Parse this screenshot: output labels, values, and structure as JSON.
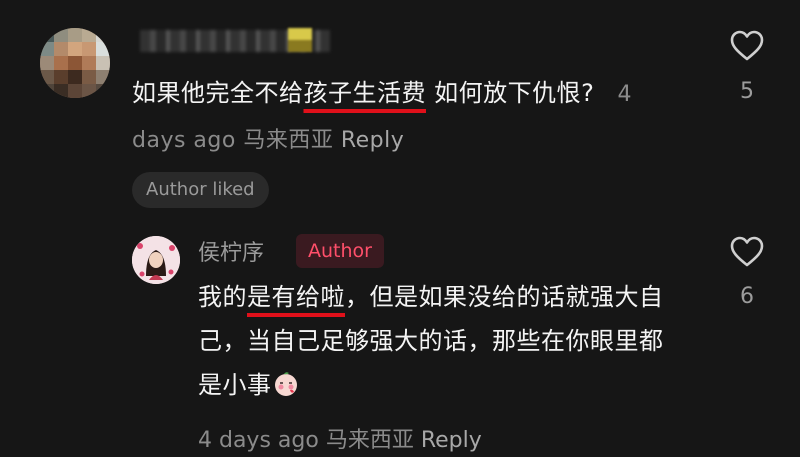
{
  "comments": [
    {
      "username": "",
      "text_before": "如果他完全不给",
      "text_underlined": "孩子生活费",
      "text_after": " 如何放下仇恨?",
      "timestamp": "4 days ago",
      "location": "马来西亚",
      "reply_label": "Reply",
      "like_count": "5",
      "author_liked_label": "Author liked"
    },
    {
      "username": "侯柠序",
      "badge": "Author",
      "text_before": "我的",
      "text_underlined": "是有给啦",
      "text_after": "，但是如果没给的话就强大自己，当自己足够强大的话，那些在你眼里都是小事",
      "timestamp": "4 days ago",
      "location": "马来西亚",
      "reply_label": "Reply",
      "like_count": "6"
    }
  ],
  "colors": {
    "background": "#161616",
    "underline": "#e0101a",
    "author_badge_text": "#ff4f6a",
    "author_badge_bg": "#3a1a20",
    "meta_text": "#8b8b8b"
  },
  "icons": {
    "like": "heart-outline-icon",
    "emoji": "blushing-face-emoji"
  }
}
